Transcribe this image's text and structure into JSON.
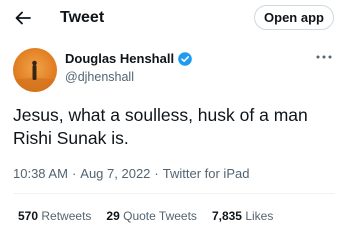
{
  "header": {
    "title": "Tweet",
    "open_app_label": "Open app"
  },
  "author": {
    "name": "Douglas Henshall",
    "handle": "@djhenshall"
  },
  "tweet": {
    "text": "Jesus, what a soulless, husk of a man Rishi Sunak is.",
    "time": "10:38 AM",
    "date": "Aug 7, 2022",
    "source": "Twitter for iPad",
    "separator": "·"
  },
  "stats": [
    {
      "count": "570",
      "label": "Retweets"
    },
    {
      "count": "29",
      "label": "Quote Tweets"
    },
    {
      "count": "7,835",
      "label": "Likes"
    }
  ],
  "colors": {
    "verified": "#1d9bf0",
    "secondary_text": "#536471",
    "avatar_bg": "#e8882a"
  },
  "icons": {
    "back": "arrow-left-icon",
    "verified": "verified-badge-icon",
    "more": "more-dots-icon"
  }
}
